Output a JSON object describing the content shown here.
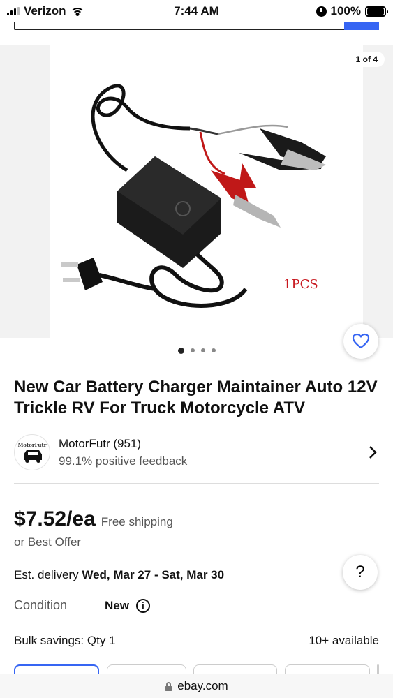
{
  "status_bar": {
    "carrier": "Verizon",
    "time": "7:44 AM",
    "battery": "100%"
  },
  "gallery": {
    "counter": "1 of 4",
    "image_caption": "1PCS",
    "dots_total": 4,
    "dots_active": 1
  },
  "product": {
    "title": "New Car Battery Charger Maintainer Auto 12V Trickle RV For Truck Motorcycle ATV"
  },
  "seller": {
    "name_line": "MotorFutr (951)",
    "feedback": "99.1% positive feedback",
    "avatar_brand": "MotorFutr"
  },
  "pricing": {
    "price": "$7.52/ea",
    "shipping": "Free shipping",
    "offer": "or Best Offer"
  },
  "delivery": {
    "label": "Est. delivery",
    "dates": "Wed, Mar 27 - Sat, Mar 30"
  },
  "condition": {
    "label": "Condition",
    "value": "New"
  },
  "bulk": {
    "label": "Bulk savings: Qty 1",
    "available": "10+ available"
  },
  "help": {
    "label": "?"
  },
  "url_bar": {
    "domain": "ebay.com"
  },
  "colors": {
    "accent": "#3665f3",
    "caption_red": "#c8171e"
  }
}
